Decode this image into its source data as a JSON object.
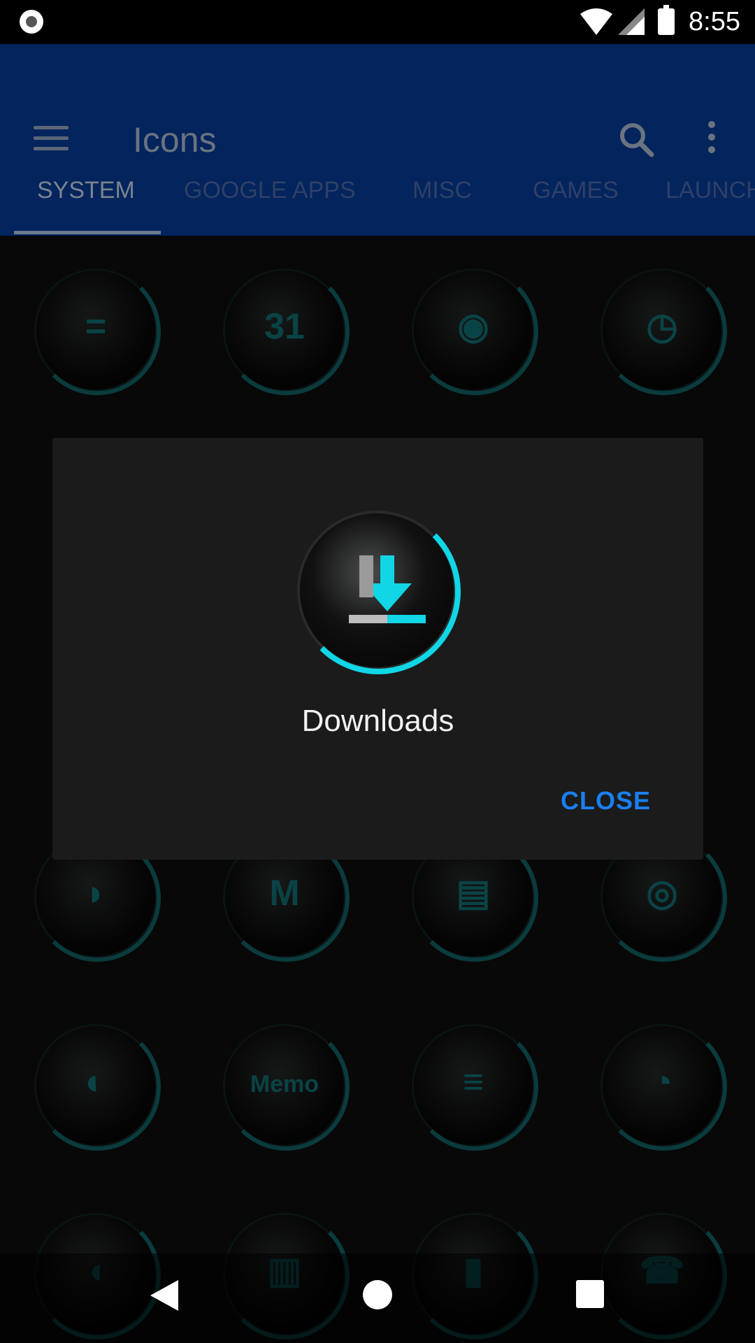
{
  "status_bar": {
    "time": "8:55"
  },
  "app_bar": {
    "title": "Icons"
  },
  "tabs": [
    {
      "label": "SYSTEM",
      "active": true
    },
    {
      "label": "GOOGLE APPS",
      "active": false
    },
    {
      "label": "MISC",
      "active": false
    },
    {
      "label": "GAMES",
      "active": false
    },
    {
      "label": "LAUNCH",
      "active": false
    }
  ],
  "grid_icons": [
    {
      "name": "calculator-icon",
      "glyph": "="
    },
    {
      "name": "calendar-icon",
      "glyph": "31"
    },
    {
      "name": "camera-icon",
      "glyph": "◉"
    },
    {
      "name": "clock-icon",
      "glyph": "◷"
    },
    {
      "name": "chrome-icon",
      "glyph": "◗"
    },
    {
      "name": "gmail-icon",
      "glyph": "M"
    },
    {
      "name": "analytics-icon",
      "glyph": "▤"
    },
    {
      "name": "instagram-icon",
      "glyph": "◎"
    },
    {
      "name": "earth-icon",
      "glyph": "◐"
    },
    {
      "name": "memo-icon",
      "glyph": "Memo"
    },
    {
      "name": "messages-icon",
      "glyph": "≡"
    },
    {
      "name": "pie-icon",
      "glyph": "◔"
    },
    {
      "name": "contacts-icon",
      "glyph": "◖"
    },
    {
      "name": "notes-icon",
      "glyph": "▥"
    },
    {
      "name": "stats-icon",
      "glyph": "▮"
    },
    {
      "name": "phone-icon",
      "glyph": "☎"
    }
  ],
  "dialog": {
    "icon": "downloads-icon",
    "name": "Downloads",
    "close_label": "CLOSE"
  },
  "colors": {
    "app_bar": "#03245c",
    "accent": "#10d6e6",
    "button": "#1a7ff0"
  }
}
